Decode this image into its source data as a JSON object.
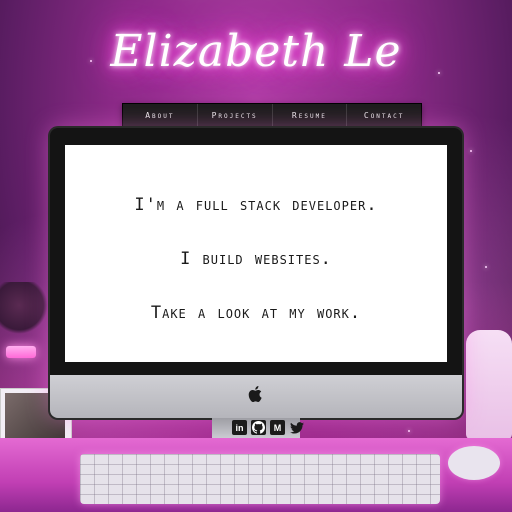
{
  "header": {
    "title": "Elizabeth Le"
  },
  "nav": {
    "items": [
      {
        "label": "About"
      },
      {
        "label": "Projects"
      },
      {
        "label": "Resume"
      },
      {
        "label": "Contact"
      }
    ]
  },
  "screen": {
    "lines": [
      "I'm a full stack developer.",
      "I build websites.",
      "Take a look at my work."
    ]
  },
  "socials": [
    {
      "icon": "linkedin-icon",
      "glyph": "in"
    },
    {
      "icon": "github-icon",
      "glyph": "●"
    },
    {
      "icon": "medium-icon",
      "glyph": "M"
    },
    {
      "icon": "twitter-icon",
      "glyph": ""
    }
  ],
  "colors": {
    "neon": "#ff3ad8",
    "nav_bg": "#1c1c1c",
    "screen_bg": "#ffffff"
  }
}
